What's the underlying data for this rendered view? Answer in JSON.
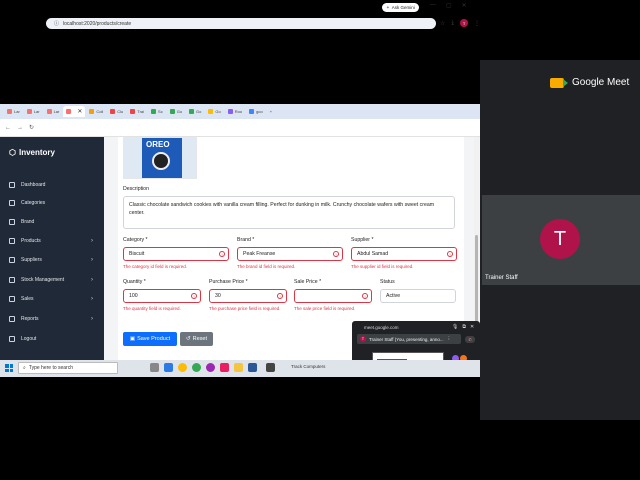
{
  "meet": {
    "logo_text": "Google Meet",
    "participant_initial": "T",
    "participant_name": "Trainer Staff"
  },
  "browser": {
    "tabs": [
      {
        "label": "Lar",
        "color": "#f87171"
      },
      {
        "label": "Lar",
        "color": "#f87171"
      },
      {
        "label": "Lar",
        "color": "#f87171"
      },
      {
        "label": "",
        "color": "#f87171",
        "active": true
      },
      {
        "label": "Coll",
        "color": "#f59e0b"
      },
      {
        "label": "Clu",
        "color": "#ef4444"
      },
      {
        "label": "Trai",
        "color": "#ef4444"
      },
      {
        "label": "Sc",
        "color": "#34a853"
      },
      {
        "label": "Go",
        "color": "#34a853"
      },
      {
        "label": "Go",
        "color": "#34a853"
      },
      {
        "label": "Go",
        "color": "#fbbc05"
      },
      {
        "label": "Roo",
        "color": "#8b5cf6"
      },
      {
        "label": "goo",
        "color": "#4285f4"
      }
    ],
    "ask_gemini": "Ask Gemini",
    "url": "localhost:2020/products/create",
    "profile_initial": "T"
  },
  "app": {
    "brand": "Inventory",
    "nav": [
      {
        "label": "Dashboard",
        "chevron": false
      },
      {
        "label": "Categories",
        "chevron": false
      },
      {
        "label": "Brand",
        "chevron": false
      },
      {
        "label": "Products",
        "chevron": true
      },
      {
        "label": "Suppliers",
        "chevron": true
      },
      {
        "label": "Stock Management",
        "chevron": true
      },
      {
        "label": "Sales",
        "chevron": true
      },
      {
        "label": "Reports",
        "chevron": true
      },
      {
        "label": "Logout",
        "chevron": false
      }
    ],
    "image_brand": "OREO",
    "description": {
      "label": "Description",
      "value": "Classic chocolate sandwich cookies with vanilla cream filling. Perfect for dunking in milk. Crunchy chocolate wafers with sweet cream center."
    },
    "category": {
      "label": "Category *",
      "value": "Biscuit",
      "error": "The category id field is required."
    },
    "brand_field": {
      "label": "Brand *",
      "value": "Peak Freanse",
      "error": "The brand id field is required."
    },
    "supplier": {
      "label": "Supplier *",
      "value": "Abdul Samad",
      "error": "The supplier id field is required."
    },
    "quantity": {
      "label": "Quantity *",
      "value": "100",
      "error": "The quantity field is required."
    },
    "purchase_price": {
      "label": "Purchase Price *",
      "value": "30",
      "error": "The purchase price field is required."
    },
    "sale_price": {
      "label": "Sale Price *",
      "value": "",
      "error": "The sale price field is required."
    },
    "status": {
      "label": "Status",
      "value": "Active"
    },
    "save_label": "Save Product",
    "reset_label": "Reset"
  },
  "popup": {
    "url": "meet.google.com",
    "presenting": "Trainer Staff (You, presenting, anno...",
    "others": "7 others"
  },
  "taskbar": {
    "search_placeholder": "Type here to search",
    "news": "Track Computers"
  }
}
